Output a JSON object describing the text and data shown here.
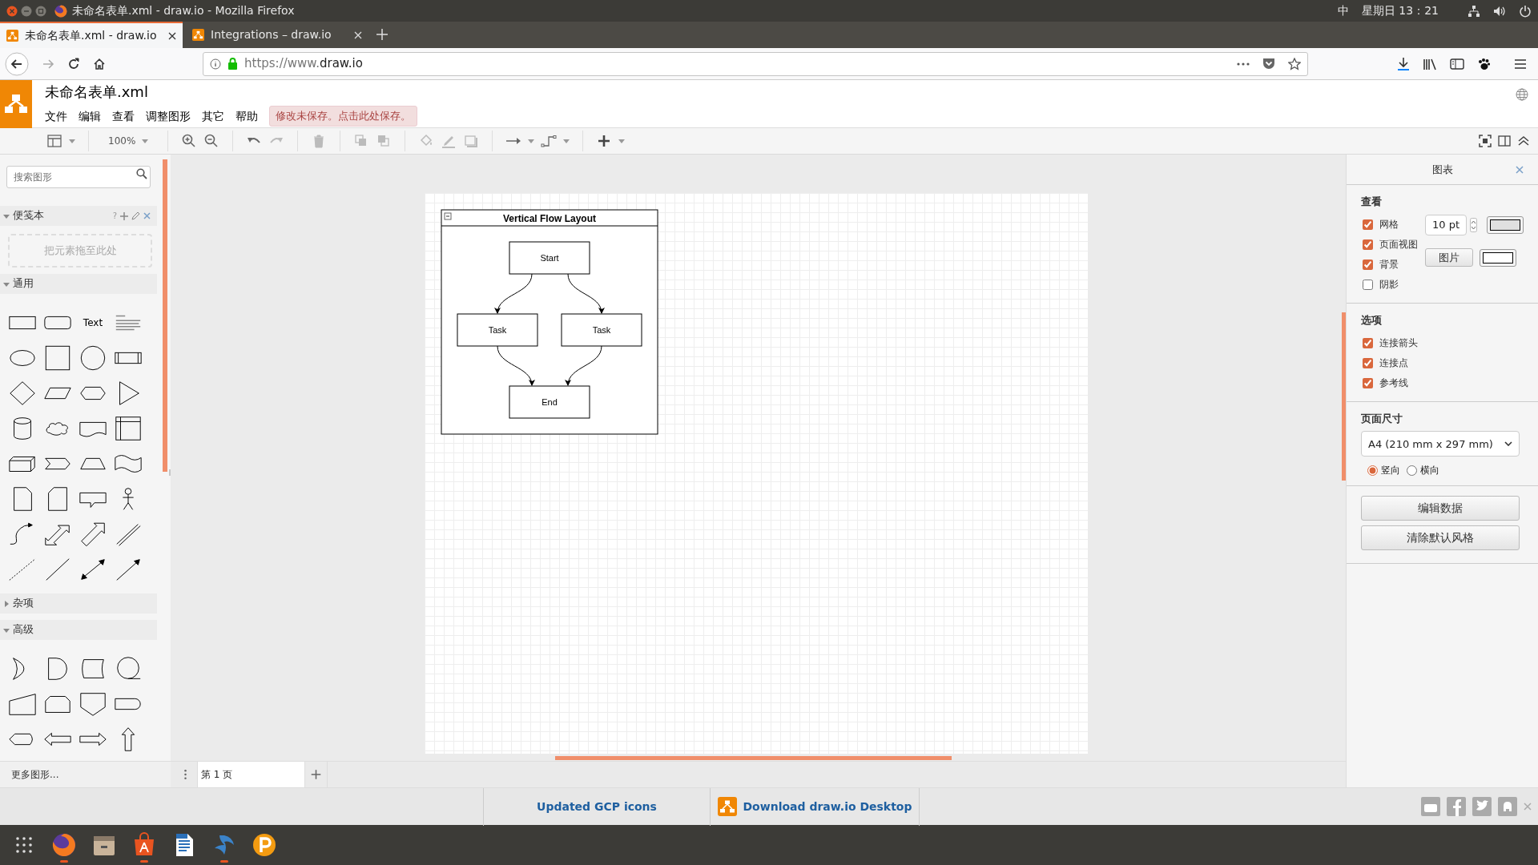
{
  "os_bar": {
    "window_title": "未命名表单.xml - draw.io - Mozilla Firefox",
    "input_method": "中",
    "clock": "星期日 13：21"
  },
  "browser": {
    "tabs": [
      {
        "label": "未命名表单.xml - draw.io",
        "selected": true
      },
      {
        "label": "Integrations – draw.io",
        "selected": false
      }
    ],
    "url_prefix": "https://www.",
    "url_domain": "draw.io"
  },
  "app": {
    "file_name": "未命名表单.xml",
    "menus": [
      "文件",
      "编辑",
      "查看",
      "调整图形",
      "其它",
      "帮助"
    ],
    "unsaved_notice": "修改未保存。点击此处保存。",
    "zoom": "100%"
  },
  "sidebar": {
    "search_placeholder": "搜索图形",
    "sections": [
      {
        "kind": "scratchpad",
        "title": "便笺本",
        "expanded": true,
        "help_label": "?",
        "drop_hint": "把元素拖至此处"
      },
      {
        "kind": "general",
        "title": "通用",
        "expanded": true,
        "text_shape": "Text"
      },
      {
        "kind": "misc",
        "title": "杂项",
        "expanded": false
      },
      {
        "kind": "advanced",
        "title": "高级",
        "expanded": true
      }
    ],
    "more_shapes": "更多图形..."
  },
  "diagram": {
    "title": "Vertical Flow Layout",
    "nodes": [
      {
        "label": "Start"
      },
      {
        "label": "Task"
      },
      {
        "label": "Task"
      },
      {
        "label": "End"
      }
    ]
  },
  "pages": [
    {
      "label": "第 1 页",
      "selected": true
    }
  ],
  "format_panel": {
    "title": "图表",
    "view_heading": "查看",
    "view_options": [
      {
        "label": "网格",
        "checked": true
      },
      {
        "label": "页面视图",
        "checked": true
      },
      {
        "label": "背景",
        "checked": true
      },
      {
        "label": "阴影",
        "checked": false
      }
    ],
    "grid_size": "10 pt",
    "image_button": "图片",
    "options_heading": "选项",
    "options": [
      {
        "label": "连接箭头",
        "checked": true
      },
      {
        "label": "连接点",
        "checked": true
      },
      {
        "label": "参考线",
        "checked": true
      }
    ],
    "page_size_heading": "页面尺寸",
    "page_size": "A4 (210 mm x 297 mm)",
    "orientations": [
      {
        "label": "竖向",
        "selected": true
      },
      {
        "label": "横向",
        "selected": false
      }
    ],
    "buttons": [
      "编辑数据",
      "清除默认风格"
    ]
  },
  "footer": {
    "links": [
      {
        "kind": "plain",
        "label": "Updated GCP icons"
      },
      {
        "kind": "download",
        "label": "Download draw.io Desktop"
      }
    ]
  }
}
